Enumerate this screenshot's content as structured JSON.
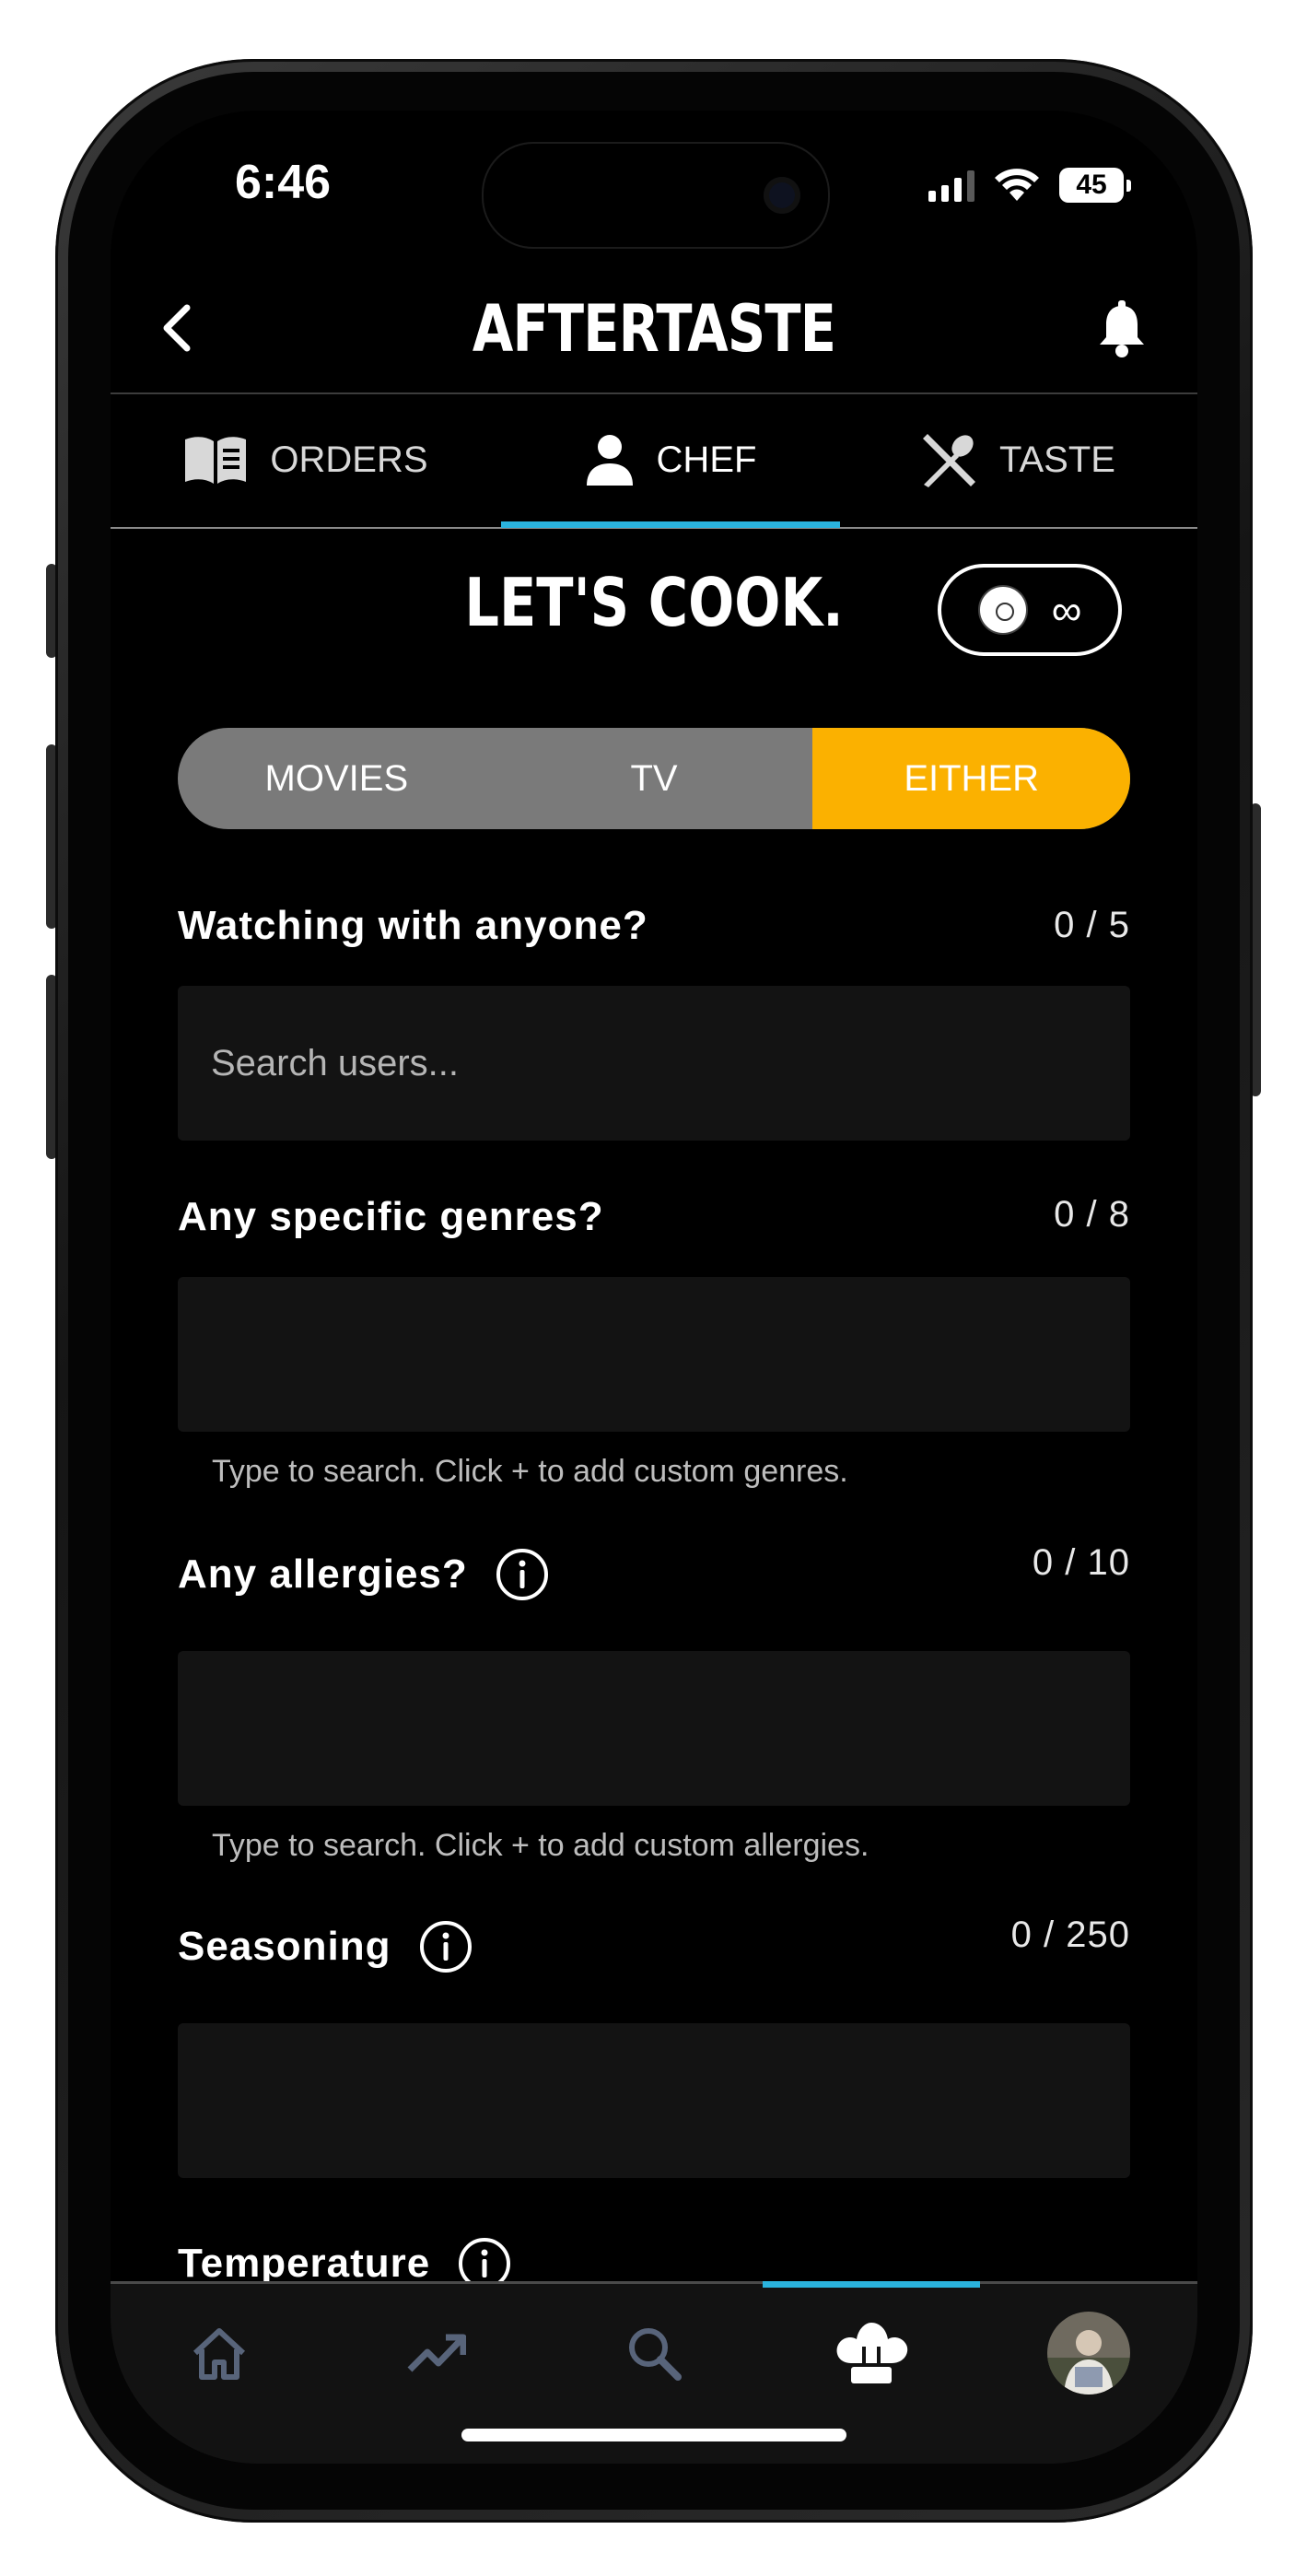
{
  "status_bar": {
    "time": "6:46",
    "battery": "45"
  },
  "header": {
    "title": "AFTERTASTE"
  },
  "tabs": [
    {
      "label": "ORDERS"
    },
    {
      "label": "CHEF"
    },
    {
      "label": "TASTE"
    }
  ],
  "page": {
    "title": "LET'S COOK.",
    "credits": "∞"
  },
  "segmented": {
    "options": [
      {
        "label": "MOVIES"
      },
      {
        "label": "TV"
      },
      {
        "label": "EITHER"
      }
    ]
  },
  "fields": {
    "watching": {
      "label": "Watching with anyone?",
      "count": "0 / 5",
      "placeholder": "Search users...",
      "value": ""
    },
    "genres": {
      "label": "Any specific genres?",
      "count": "0 / 8",
      "value": "",
      "help": "Type to search. Click + to add custom genres."
    },
    "allergies": {
      "label": "Any allergies?",
      "count": "0 / 10",
      "value": "",
      "help": "Type to search. Click + to add custom allergies."
    },
    "seasoning": {
      "label": "Seasoning",
      "count": "0 / 250",
      "value": ""
    },
    "temperature": {
      "label": "Temperature"
    }
  },
  "colors": {
    "accent": "#2ab3dd",
    "selected": "#fbb100",
    "segment_bg": "#7a7a7a",
    "field_bg": "#131313"
  },
  "bottom_nav": {
    "items": [
      {
        "icon": "home-icon"
      },
      {
        "icon": "trending-icon"
      },
      {
        "icon": "search-icon"
      },
      {
        "icon": "chef-hat-icon"
      },
      {
        "icon": "profile-avatar"
      }
    ]
  }
}
